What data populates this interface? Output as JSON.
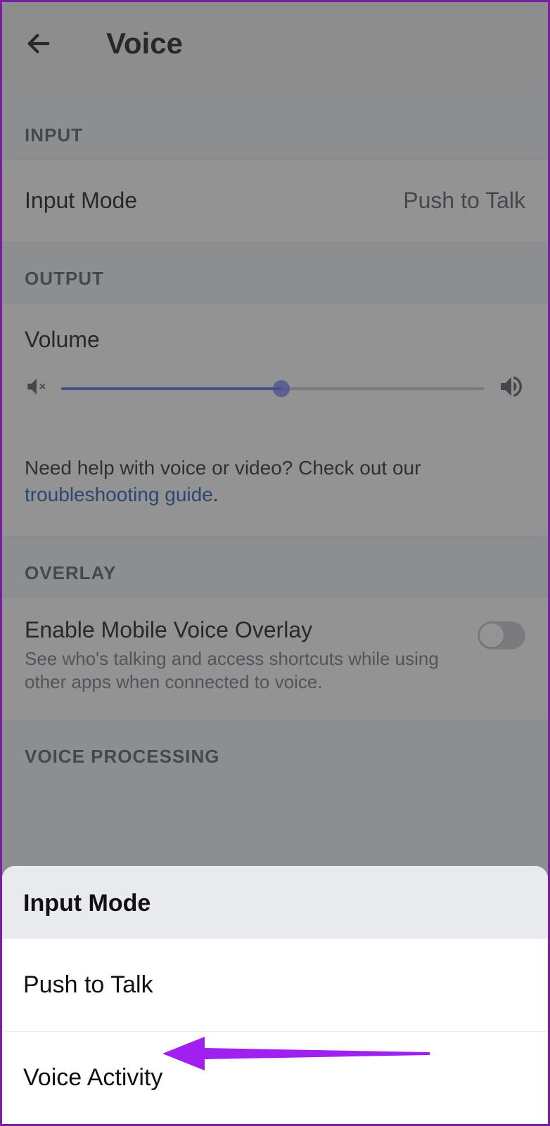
{
  "header": {
    "title": "Voice"
  },
  "sections": {
    "input": {
      "label": "INPUT",
      "mode_label": "Input Mode",
      "mode_value": "Push to Talk"
    },
    "output": {
      "label": "OUTPUT",
      "volume_label": "Volume"
    },
    "help": {
      "text": "Need help with voice or video? Check out our ",
      "link": "troubleshooting guide",
      "suffix": "."
    },
    "overlay": {
      "label": "OVERLAY",
      "title": "Enable Mobile Voice Overlay",
      "desc": "See who's talking and access shortcuts while using other apps when connected to voice."
    },
    "voice_processing": {
      "label": "VOICE PROCESSING"
    }
  },
  "sheet": {
    "title": "Input Mode",
    "options": {
      "opt1": "Push to Talk",
      "opt2": "Voice Activity"
    }
  }
}
